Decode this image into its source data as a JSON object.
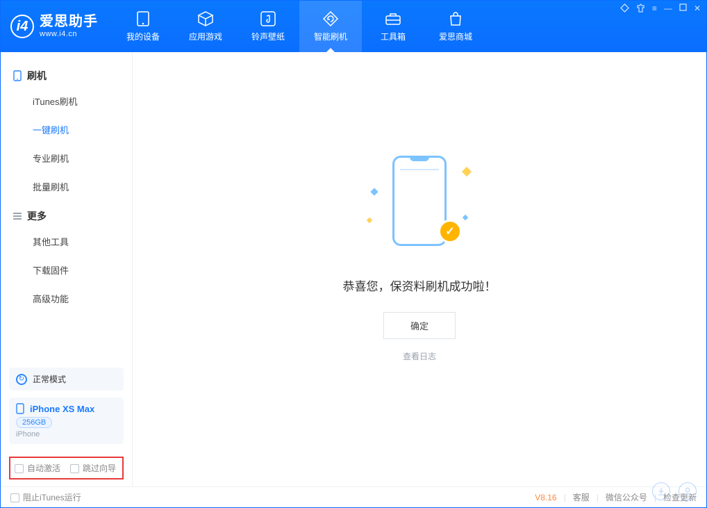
{
  "app": {
    "name": "爱思助手",
    "url": "www.i4.cn"
  },
  "nav": {
    "items": [
      {
        "label": "我的设备"
      },
      {
        "label": "应用游戏"
      },
      {
        "label": "铃声壁纸"
      },
      {
        "label": "智能刷机"
      },
      {
        "label": "工具箱"
      },
      {
        "label": "爱思商城"
      }
    ]
  },
  "sidebar": {
    "section_flash": "刷机",
    "flash_items": [
      {
        "label": "iTunes刷机"
      },
      {
        "label": "一键刷机"
      },
      {
        "label": "专业刷机"
      },
      {
        "label": "批量刷机"
      }
    ],
    "section_more": "更多",
    "more_items": [
      {
        "label": "其他工具"
      },
      {
        "label": "下载固件"
      },
      {
        "label": "高级功能"
      }
    ],
    "mode_label": "正常模式",
    "device": {
      "name": "iPhone XS Max",
      "storage": "256GB",
      "type": "iPhone"
    },
    "opt_auto_activate": "自动激活",
    "opt_skip_guide": "跳过向导"
  },
  "main": {
    "success_msg": "恭喜您，保资料刷机成功啦！",
    "ok_label": "确定",
    "log_link": "查看日志"
  },
  "footer": {
    "stop_itunes": "阻止iTunes运行",
    "version": "V8.16",
    "link_support": "客服",
    "link_wechat": "微信公众号",
    "link_update": "检查更新"
  }
}
